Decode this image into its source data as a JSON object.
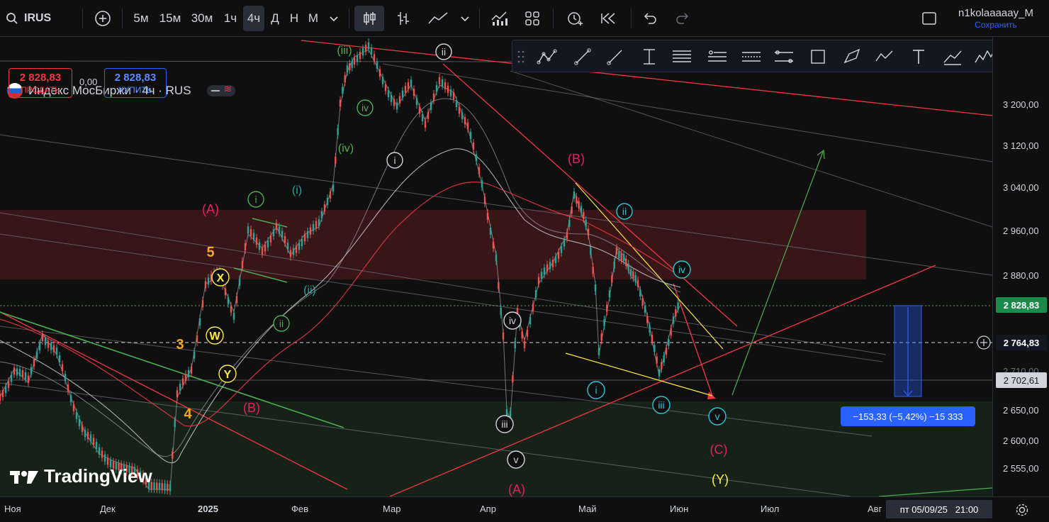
{
  "topbar": {
    "symbol": "IRUS",
    "timeframes": [
      "5м",
      "15м",
      "30м",
      "1ч",
      "4ч",
      "Д",
      "Н",
      "М"
    ],
    "active_timeframe": "4ч",
    "username": "n1kolaaaaay_M",
    "save_label": "Сохранить"
  },
  "legend": {
    "title": "Индекс МосБиржи · 4ч · RUS",
    "sell_price": "2 828,83",
    "sell_label": "ПРОДАТЬ",
    "spread": "0,00",
    "buy_price": "2 828,83",
    "buy_label": "КУПИТЬ"
  },
  "price_axis": {
    "ticks": [
      "3 200,00",
      "3 120,00",
      "3 040,00",
      "2 960,00",
      "2 880,00",
      "2 650,00",
      "2 600,00",
      "2 555,00"
    ],
    "current_price": "2 828,83",
    "crosshair_price": "2 764,83",
    "line_price": "2 702,61",
    "partial_tick": "2 710,00"
  },
  "time_axis": {
    "labels": [
      "Ноя",
      "Дек",
      "2025",
      "Фев",
      "Мар",
      "Апр",
      "Май",
      "Июн",
      "Июл",
      "Авг"
    ],
    "crosshair_time": "пт 05/09/25   21:00"
  },
  "measure": {
    "label": "−153,33 (−5,42%) −15 333"
  },
  "wave_labels": {
    "green_iii": "(iii)",
    "green_iv": "(iv)",
    "green_i_paren": "(i)",
    "green_ii_paren": "(ii)",
    "circle_ii_top": "ii",
    "circle_iv_green": "iv",
    "circle_i_white": "i",
    "B_red": "(B)",
    "A_red": "(A)",
    "i_green": "i",
    "ii_green": "ii",
    "five": "5",
    "three": "3",
    "four": "4",
    "X": "X",
    "W": "W",
    "Y": "Y",
    "B_red_low": "(B)",
    "ii_blue": "ii",
    "iv_blue": "iv",
    "iv_white": "iv",
    "iii_white": "iii",
    "v_white": "v",
    "A_red_low": "(A)",
    "i_blue": "i",
    "iii_blue": "iii",
    "v_blue": "v",
    "C_red": "(C)",
    "Y_yellow": "(Y)"
  },
  "watermark": "TradingView",
  "colors": {
    "red": "#f23645",
    "green": "#4caf50",
    "blue": "#2962ff",
    "yellow": "#ffeb3b",
    "wave_green": "#4caf50",
    "wave_blue": "#26c6da",
    "wave_red": "#e91e63"
  }
}
